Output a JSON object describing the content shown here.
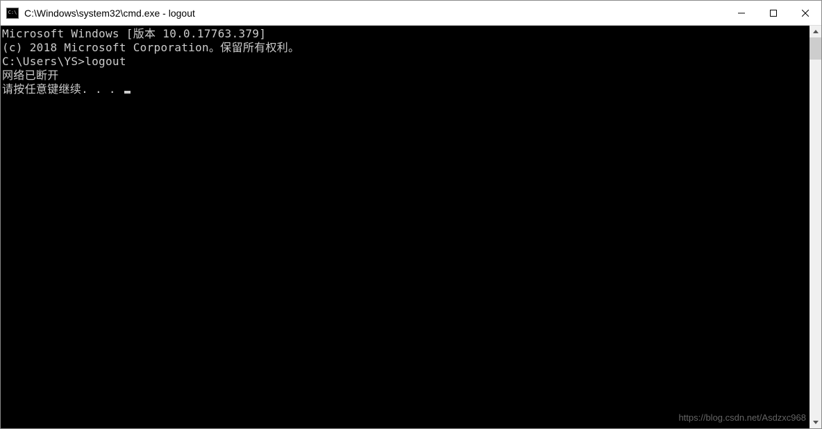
{
  "window": {
    "title": "C:\\Windows\\system32\\cmd.exe - logout"
  },
  "terminal": {
    "line1": "Microsoft Windows [版本 10.0.17763.379]",
    "line2": "(c) 2018 Microsoft Corporation。保留所有权利。",
    "line3": "",
    "line4": "C:\\Users\\YS>logout",
    "line5": "网络已断开",
    "line6": "请按任意键继续. . . "
  },
  "watermark": "https://blog.csdn.net/Asdzxc968"
}
